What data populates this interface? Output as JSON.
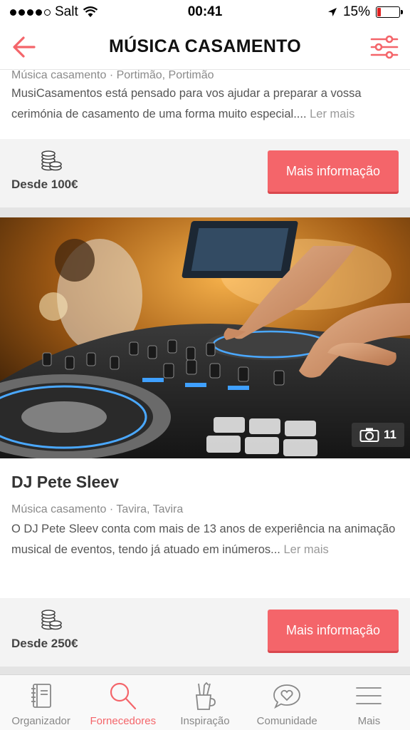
{
  "status_bar": {
    "carrier": "Salt",
    "time": "00:41",
    "battery": "15%",
    "battery_level": 0.15
  },
  "header": {
    "title": "MÚSICA CASAMENTO"
  },
  "listings": [
    {
      "meta": "Música casamento · Portimão, Portimão",
      "description": "MusiCasamentos está pensado para vos ajudar a preparar a vossa cerimónia de casamento de uma forma muito especial....",
      "more": "Ler mais",
      "price": "Desde 100€",
      "button": "Mais informação"
    },
    {
      "name": "DJ Pete Sleev",
      "photo_count": "11",
      "meta": "Música casamento · Tavira, Tavira",
      "description": "O DJ Pete Sleev conta com mais de 13 anos de experiência na animação musical de eventos, tendo já atuado em inúmeros...",
      "more": "Ler mais",
      "price": "Desde 250€",
      "button": "Mais informação"
    }
  ],
  "tabs": [
    {
      "label": "Organizador",
      "icon": "notebook-icon"
    },
    {
      "label": "Fornecedores",
      "icon": "search-icon",
      "active": true
    },
    {
      "label": "Inspiração",
      "icon": "pencil-cup-icon"
    },
    {
      "label": "Comunidade",
      "icon": "heart-bubble-icon"
    },
    {
      "label": "Mais",
      "icon": "menu-icon"
    }
  ],
  "colors": {
    "accent": "#f4656a",
    "button_shadow": "#d9474d",
    "price_bar_bg": "#f3f3f3"
  }
}
